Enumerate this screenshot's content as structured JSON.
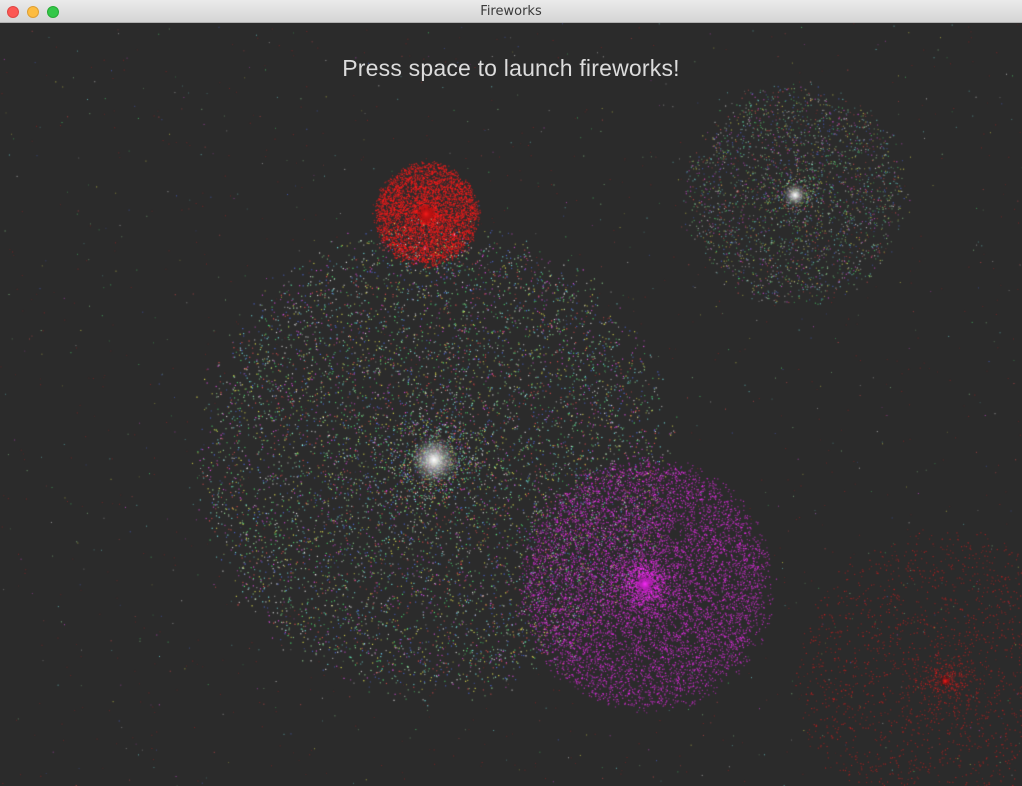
{
  "window": {
    "title": "Fireworks"
  },
  "canvas": {
    "background": "#2b2b2b",
    "prompt": "Press space to launch fireworks!"
  },
  "fireworks": [
    {
      "color": "#ff1a1a",
      "style": "solid"
    },
    {
      "color": "#ffffff",
      "style": "multicolor"
    },
    {
      "color": "#ff2cff",
      "style": "solid"
    },
    {
      "color": "#ffffff",
      "style": "multicolor"
    },
    {
      "color": "#ff1a1a",
      "style": "solid"
    }
  ],
  "multicolor_palette": [
    "#7fffff",
    "#ffffff",
    "#ffff55",
    "#ff55ff",
    "#55ff7f",
    "#5577ff",
    "#ff5555",
    "#aaffaa"
  ]
}
